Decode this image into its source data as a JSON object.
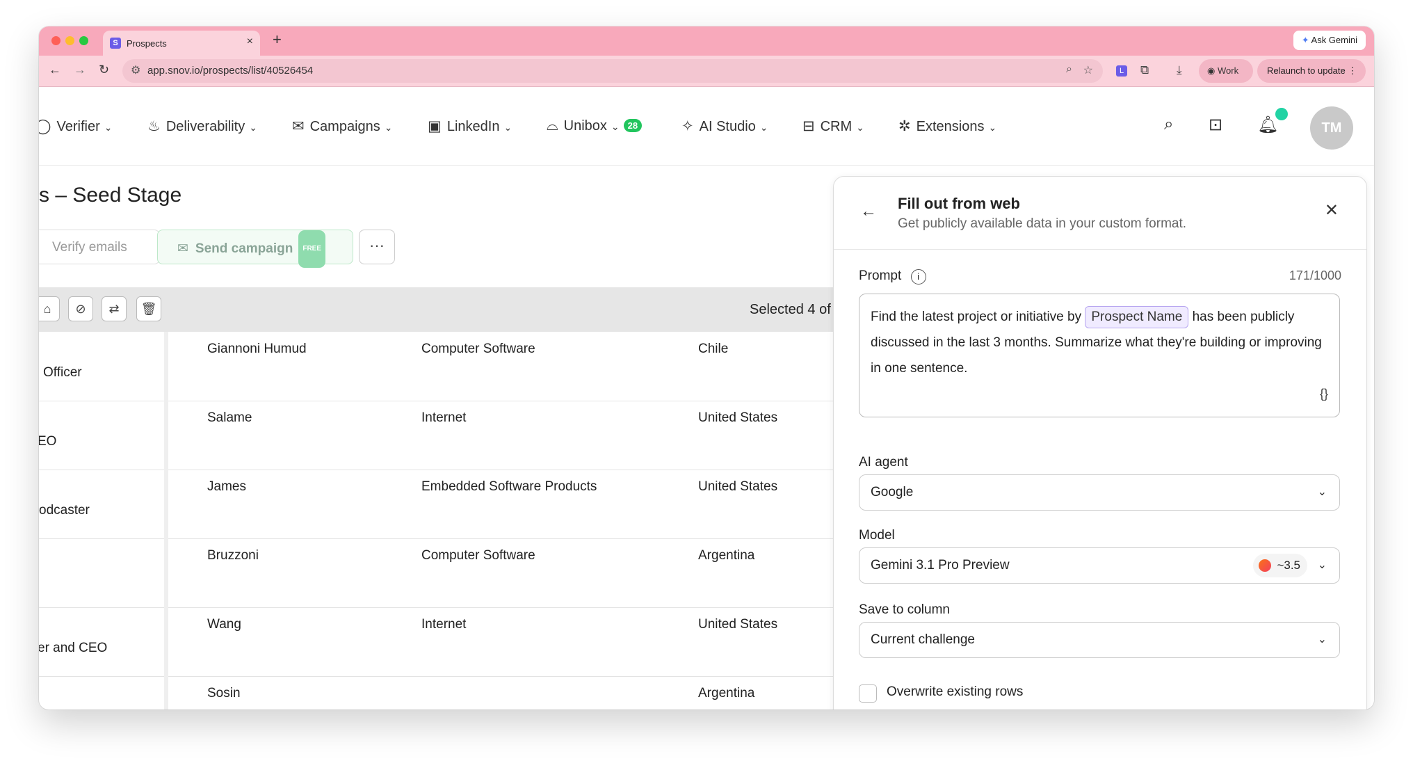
{
  "browser": {
    "tab_title": "Prospects",
    "tab_favicon": "S",
    "url": "app.snov.io/prospects/list/40526454",
    "ask_gemini": "Ask Gemini",
    "work_label": "Work",
    "relaunch_label": "Relaunch to update"
  },
  "nav": {
    "items": [
      {
        "label": "Verifier",
        "icon": "check-circle-icon"
      },
      {
        "label": "Deliverability",
        "icon": "flame-icon"
      },
      {
        "label": "Campaigns",
        "icon": "envelope-icon"
      },
      {
        "label": "LinkedIn",
        "icon": "linkedin-icon"
      },
      {
        "label": "Unibox",
        "icon": "inbox-icon",
        "badge": "28"
      },
      {
        "label": "AI Studio",
        "icon": "sparkles-icon"
      },
      {
        "label": "CRM",
        "icon": "crm-icon"
      },
      {
        "label": "Extensions",
        "icon": "puzzle-icon"
      }
    ],
    "avatar_initials": "TM"
  },
  "page": {
    "title": "s – Seed Stage",
    "verify_label": "Verify emails",
    "send_label": "Send campaign",
    "free_badge": "FREE",
    "more_label": "···",
    "selected_text": "Selected 4 of"
  },
  "table": {
    "rows": [
      {
        "position": "Officer",
        "name": "Giannoni Humud",
        "industry": "Computer Software",
        "country": "Chile"
      },
      {
        "position": "EO",
        "name": "Salame",
        "industry": "Internet",
        "country": "United States"
      },
      {
        "position": "odcaster",
        "name": "James",
        "industry": "Embedded Software Products",
        "country": "United States"
      },
      {
        "position": "",
        "name": "Bruzzoni",
        "industry": "Computer Software",
        "country": "Argentina"
      },
      {
        "position": "er and CEO",
        "name": "Wang",
        "industry": "Internet",
        "country": "United States"
      },
      {
        "position": "",
        "name": "Sosin",
        "industry": "",
        "country": "Argentina"
      }
    ]
  },
  "panel": {
    "title": "Fill out from web",
    "subtitle": "Get publicly available data in your custom format.",
    "prompt_label": "Prompt",
    "counter": "171/1000",
    "prompt_before": "Find the latest project or initiative by",
    "prompt_chip": "Prospect Name",
    "prompt_after": "has been publicly discussed in the last 3 months. Summarize what they're building or improving in one sentence.",
    "braces": "{}",
    "agent_label": "AI agent",
    "agent_value": "Google",
    "model_label": "Model",
    "model_value": "Gemini 3.1 Pro Preview",
    "model_cost": "~3.5",
    "save_label": "Save to column",
    "save_value": "Current challenge",
    "overwrite_label": "Overwrite existing rows"
  },
  "colors": {
    "tabstrip": "#f8a9bb",
    "toolbar": "#fbd3dc",
    "badge_green": "#22c55e",
    "chip_bg": "#f0ebff"
  }
}
